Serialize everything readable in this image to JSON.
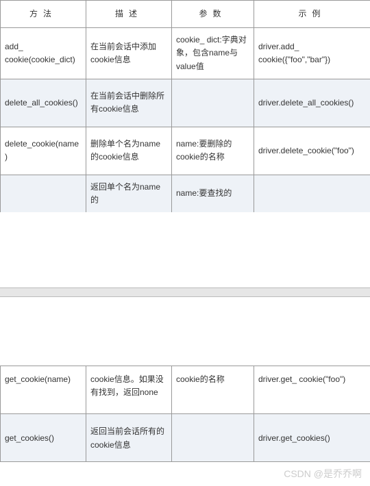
{
  "headers": {
    "method": "方法",
    "desc": "描述",
    "param": "参数",
    "example": "示例"
  },
  "table1": {
    "rows": [
      {
        "method": "add_ cookie(cookie_dict)",
        "desc": "在当前会话中添加cookie信息",
        "param": "cookie_ dict:字典对象，包含name与value值",
        "example": "driver.add_ cookie({\"foo\",\"bar\"})",
        "highlight": false
      },
      {
        "method": "delete_all_cookies()",
        "desc": "在当前会话中删除所有cookie信息",
        "param": "",
        "example": "driver.delete_all_cookies()",
        "highlight": true
      },
      {
        "method": "delete_cookie(name)",
        "desc": "删除单个名为name的cookie信息",
        "param": "name:要删除的cookie的名称",
        "example": "driver.delete_cookie(\"foo\")",
        "highlight": false
      },
      {
        "method": "",
        "desc": "返回单个名为name的",
        "param": "name:要查找的",
        "example": "",
        "highlight": true
      }
    ]
  },
  "table2": {
    "rows": [
      {
        "method": "get_cookie(name)",
        "desc": "cookie信息。如果没有找到，返回none",
        "param": "cookie的名称",
        "example": "driver.get_ cookie(\"foo\")",
        "highlight": false
      },
      {
        "method": "get_cookies()",
        "desc": "返回当前会话所有的cookie信息",
        "param": "",
        "example": "driver.get_cookies()",
        "highlight": true
      }
    ]
  },
  "watermark": "CSDN @是乔乔啊"
}
